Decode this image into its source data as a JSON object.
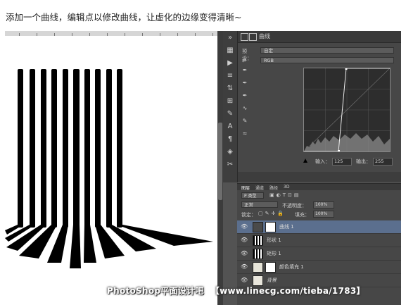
{
  "caption": "添加一个曲线，编辑点以修改曲线，让虚化的边缘变得清晰~",
  "properties": {
    "title": "曲线",
    "preset_label": "预设：",
    "preset_value": "自定",
    "channel_value": "RGB",
    "input_label": "输入：",
    "input_value": "125",
    "output_label": "输出：",
    "output_value": "255"
  },
  "layers": {
    "tabs": [
      "图层",
      "通道",
      "路径",
      "3D"
    ],
    "filter_kind": "P 类型",
    "blend_mode": "正常",
    "opacity_label": "不透明度：",
    "opacity_value": "100%",
    "lock_label": "锁定：",
    "fill_label": "填充：",
    "fill_value": "100%",
    "items": [
      {
        "name": "曲线 1",
        "selected": true
      },
      {
        "name": "形状 1",
        "selected": false
      },
      {
        "name": "矩形 1",
        "selected": false
      },
      {
        "name": "颜色填充 1",
        "selected": false
      },
      {
        "name": "背景",
        "selected": false
      }
    ]
  },
  "watermark": {
    "brand": "PhotoShop平面设计吧",
    "url": "【www.linecg.com/tieba/1783】"
  },
  "icons": {
    "eye": "eye-icon",
    "curves": "curves-icon"
  }
}
